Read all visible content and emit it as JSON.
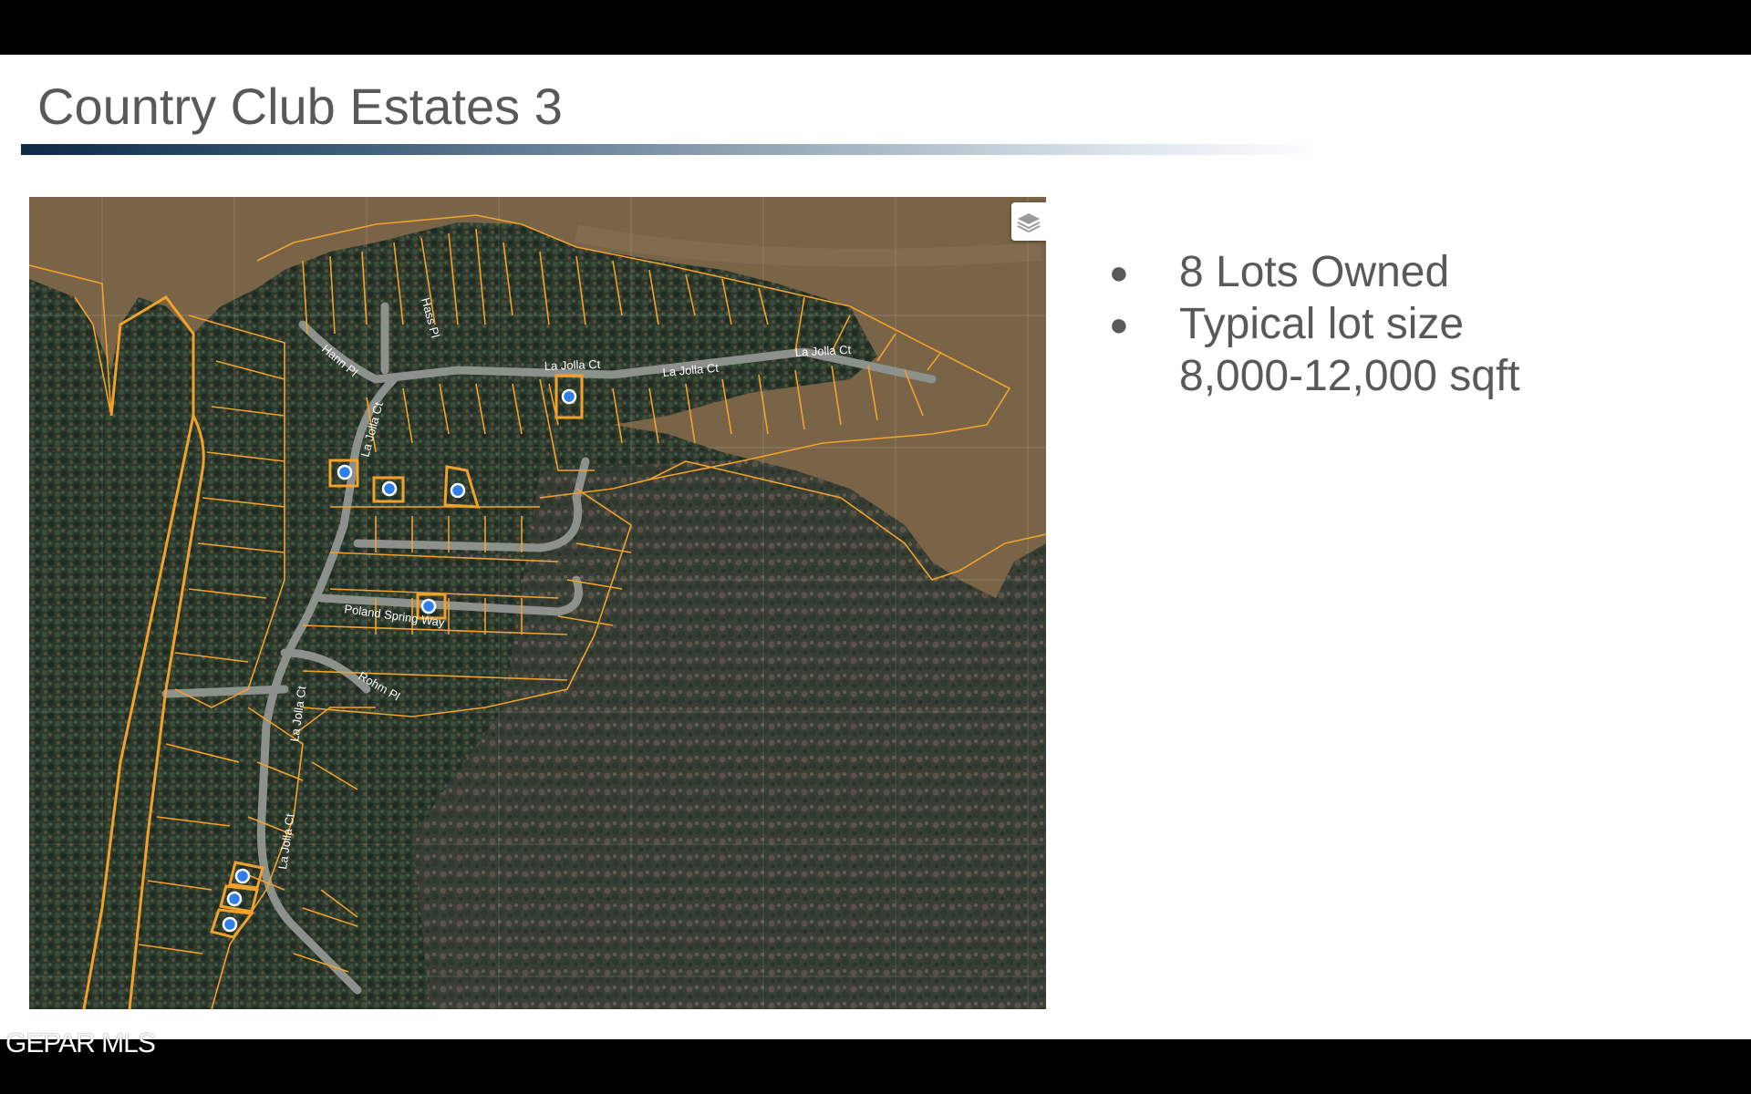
{
  "slide": {
    "title": "Country Club Estates 3",
    "bullets": [
      "8 Lots Owned",
      "Typical lot size 8,000-12,000 sqft"
    ],
    "footer": "GEPAR MLS"
  },
  "map": {
    "streets": [
      "La Jolla Ct",
      "La Jolla Ct",
      "La Jolla Ct",
      "La Jolla Ct",
      "La Jolla Ct",
      "La Jolla Ct",
      "Hann Pl",
      "Hass Pl",
      "Poland Spring Way",
      "Rohm Pl"
    ],
    "owned_lot_count": 8,
    "colors": {
      "water": "#7a6447",
      "forest": "#2b3a2c",
      "parcel": "#f2a22a",
      "marker": "#2f7fe6"
    },
    "icons": [
      "layers-icon",
      "location-marker-icon"
    ]
  }
}
